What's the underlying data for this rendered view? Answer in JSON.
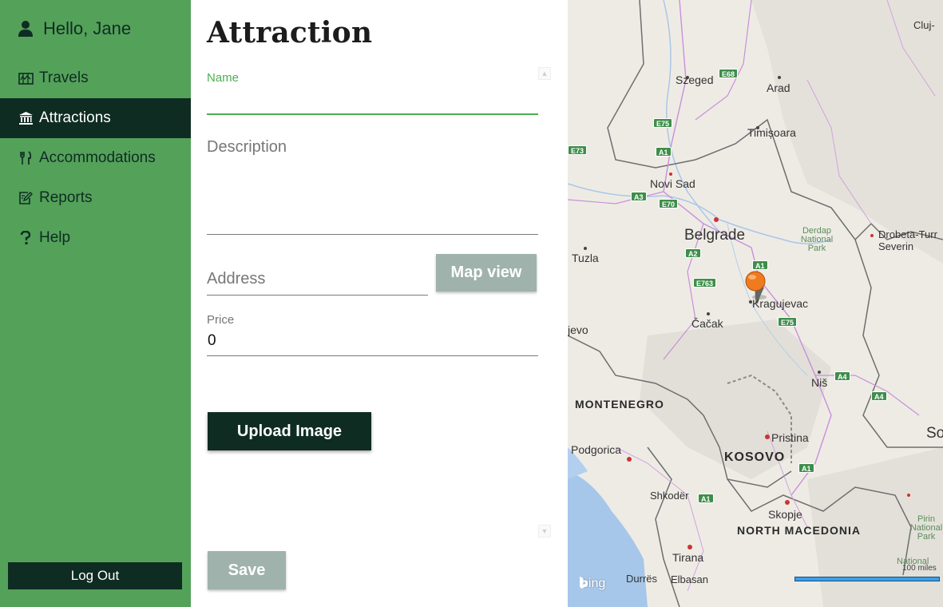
{
  "sidebar": {
    "greeting": "Hello, Jane",
    "items": [
      {
        "label": "Travels",
        "icon": "map-icon",
        "active": false
      },
      {
        "label": "Attractions",
        "icon": "landmark-icon",
        "active": true
      },
      {
        "label": "Accommodations",
        "icon": "fork-knife-icon",
        "active": false
      },
      {
        "label": "Reports",
        "icon": "edit-report-icon",
        "active": false
      },
      {
        "label": "Help",
        "icon": "question-icon",
        "active": false
      }
    ],
    "logout_label": "Log Out"
  },
  "form": {
    "title": "Attraction",
    "name": {
      "label": "Name",
      "value": ""
    },
    "description": {
      "placeholder": "Description",
      "value": ""
    },
    "address": {
      "placeholder": "Address",
      "value": ""
    },
    "map_view_label": "Map view",
    "price": {
      "label": "Price",
      "value": "0"
    },
    "upload_label": "Upload Image",
    "save_label": "Save"
  },
  "map": {
    "cities": [
      {
        "name": "Szeged"
      },
      {
        "name": "Arad"
      },
      {
        "name": "Timișoara"
      },
      {
        "name": "Novi Sad"
      },
      {
        "name": "Belgrade"
      },
      {
        "name": "Tuzla"
      },
      {
        "name": "Kragujevac"
      },
      {
        "name": "Čačak"
      },
      {
        "name": "Niš"
      },
      {
        "name": "Pristina"
      },
      {
        "name": "Podgorica"
      },
      {
        "name": "Shkodër"
      },
      {
        "name": "Skopje"
      },
      {
        "name": "Tirana"
      },
      {
        "name": "Durrës"
      },
      {
        "name": "Elbasan"
      },
      {
        "name": "Severin"
      },
      {
        "name": "Drobeta-Turr"
      },
      {
        "name": "Cluj-"
      },
      {
        "name": "jevo"
      },
      {
        "name": "So"
      }
    ],
    "countries": [
      "MONTENEGRO",
      "KOSOVO",
      "NORTH MACEDONIA"
    ],
    "parks": [
      "Derdap National Park",
      "Pirin National Park",
      "National"
    ],
    "highways": [
      "E68",
      "E75",
      "A1",
      "E73",
      "A3",
      "E70",
      "A2",
      "E763",
      "A1",
      "E75",
      "A4",
      "A4",
      "A1",
      "A1"
    ],
    "scale_label": "100 miles",
    "provider": "bing",
    "pin_location": "Kragujevac"
  },
  "colors": {
    "sidebar_bg": "#54a15a",
    "dark_accent": "#0f2c22",
    "focus_green": "#4caf50",
    "disabled_button": "#9fb2ac",
    "pin_orange": "#f07a1e"
  }
}
